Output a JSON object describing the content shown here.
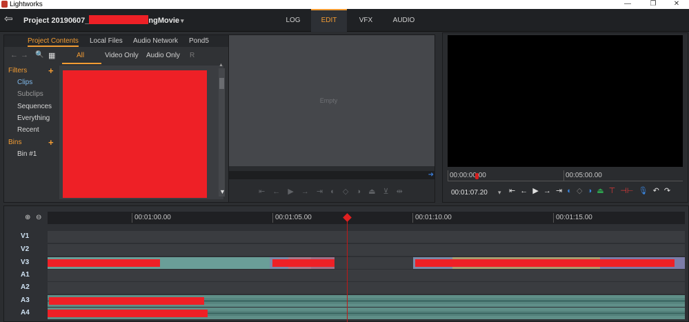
{
  "window": {
    "title": "Lightworks",
    "minimize": "—",
    "maximize": "❐",
    "close": "✕"
  },
  "header": {
    "exit_icon": "exit-icon",
    "project_title_prefix": "Project 20190607_",
    "project_title_suffix": "ngMovie",
    "project_caret": "▾",
    "tabs": [
      {
        "label": "LOG",
        "active": false
      },
      {
        "label": "EDIT",
        "active": true
      },
      {
        "label": "VFX",
        "active": false
      },
      {
        "label": "AUDIO",
        "active": false
      }
    ],
    "accent_color": "#f39c33"
  },
  "content_panel": {
    "tabs": [
      {
        "label": "Project Contents",
        "active": true
      },
      {
        "label": "Local Files",
        "active": false
      },
      {
        "label": "Audio Network",
        "active": false
      },
      {
        "label": "Pond5",
        "active": false
      }
    ],
    "toolbar": {
      "back": "←",
      "forward": "→",
      "search": "🔍",
      "grid": "▦"
    },
    "filter_tabs": [
      {
        "label": "All",
        "active": true
      },
      {
        "label": "Video Only",
        "active": false
      },
      {
        "label": "Audio Only",
        "active": false
      },
      {
        "label": "R",
        "active": false
      }
    ],
    "filters_header": "Filters",
    "filters": [
      "Clips",
      "Subclips",
      "Sequences",
      "Everything",
      "Recent"
    ],
    "bins_header": "Bins",
    "bins": [
      "Bin #1"
    ],
    "plus": "+"
  },
  "source_viewer": {
    "status": "Empty",
    "controls": "⇤ ← ▶ → ⇥ ◐ ◇ ◑ ⏏ ⊻ ⇹"
  },
  "record_viewer": {
    "ruler": [
      "00:00:00.00",
      "00:05:00.00"
    ],
    "timecode": "00:01:07.20",
    "tc_caret": "▾",
    "controls": [
      "⇤",
      "←",
      "▶",
      "→",
      "⇥",
      "◐",
      "◇",
      "◑",
      "⏏",
      "⊤",
      "⊣⊢",
      "🎙",
      "↶",
      "↷"
    ]
  },
  "timeline": {
    "zoom_in": "⊕",
    "zoom_out": "⊖",
    "ruler": [
      "00:01:00.00",
      "00:01:05.00",
      "00:01:10.00",
      "00:01:15.00"
    ],
    "tracks": [
      "V1",
      "V2",
      "V3",
      "A1",
      "A2",
      "A3",
      "A4"
    ]
  }
}
